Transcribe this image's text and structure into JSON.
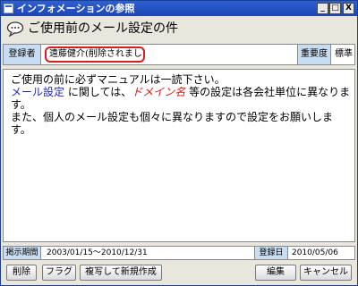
{
  "window": {
    "title": "インフォメーションの参照"
  },
  "titlebar_buttons": {
    "minimize": "_",
    "maximize": "□",
    "close": "X"
  },
  "heading": {
    "icon": "speech-balloon-icon",
    "title": "ご使用前のメール設定の件"
  },
  "sender": {
    "label": "登録者",
    "value": "遠藤健介(削除されました)"
  },
  "importance": {
    "label": "重要度",
    "value": "標準"
  },
  "body": {
    "line1": "ご使用の前に必ずマニュアルは一読下さい。",
    "link_text": "メール設定",
    "text2": "に関しては、",
    "domain_text": "ドメイン名",
    "text3": "等の設定は各会社単位に異なります。",
    "line3": "また、個人のメール設定も個々に異なりますので設定をお願いします。"
  },
  "period": {
    "label": "掲示期間",
    "value": "2003/01/15～2010/12/31"
  },
  "registered": {
    "label": "登録日",
    "value": "2010/05/06"
  },
  "buttons": {
    "delete": "削除",
    "flag": "フラグ",
    "copy_new": "複写して新規作成",
    "edit": "編集",
    "cancel": "キャンセル"
  },
  "colors": {
    "titlebar": "#1d47b4",
    "label_bg": "#c9ddf2",
    "highlight_border": "#d62020",
    "link": "#1d27c8",
    "emphasis": "#e01818"
  }
}
